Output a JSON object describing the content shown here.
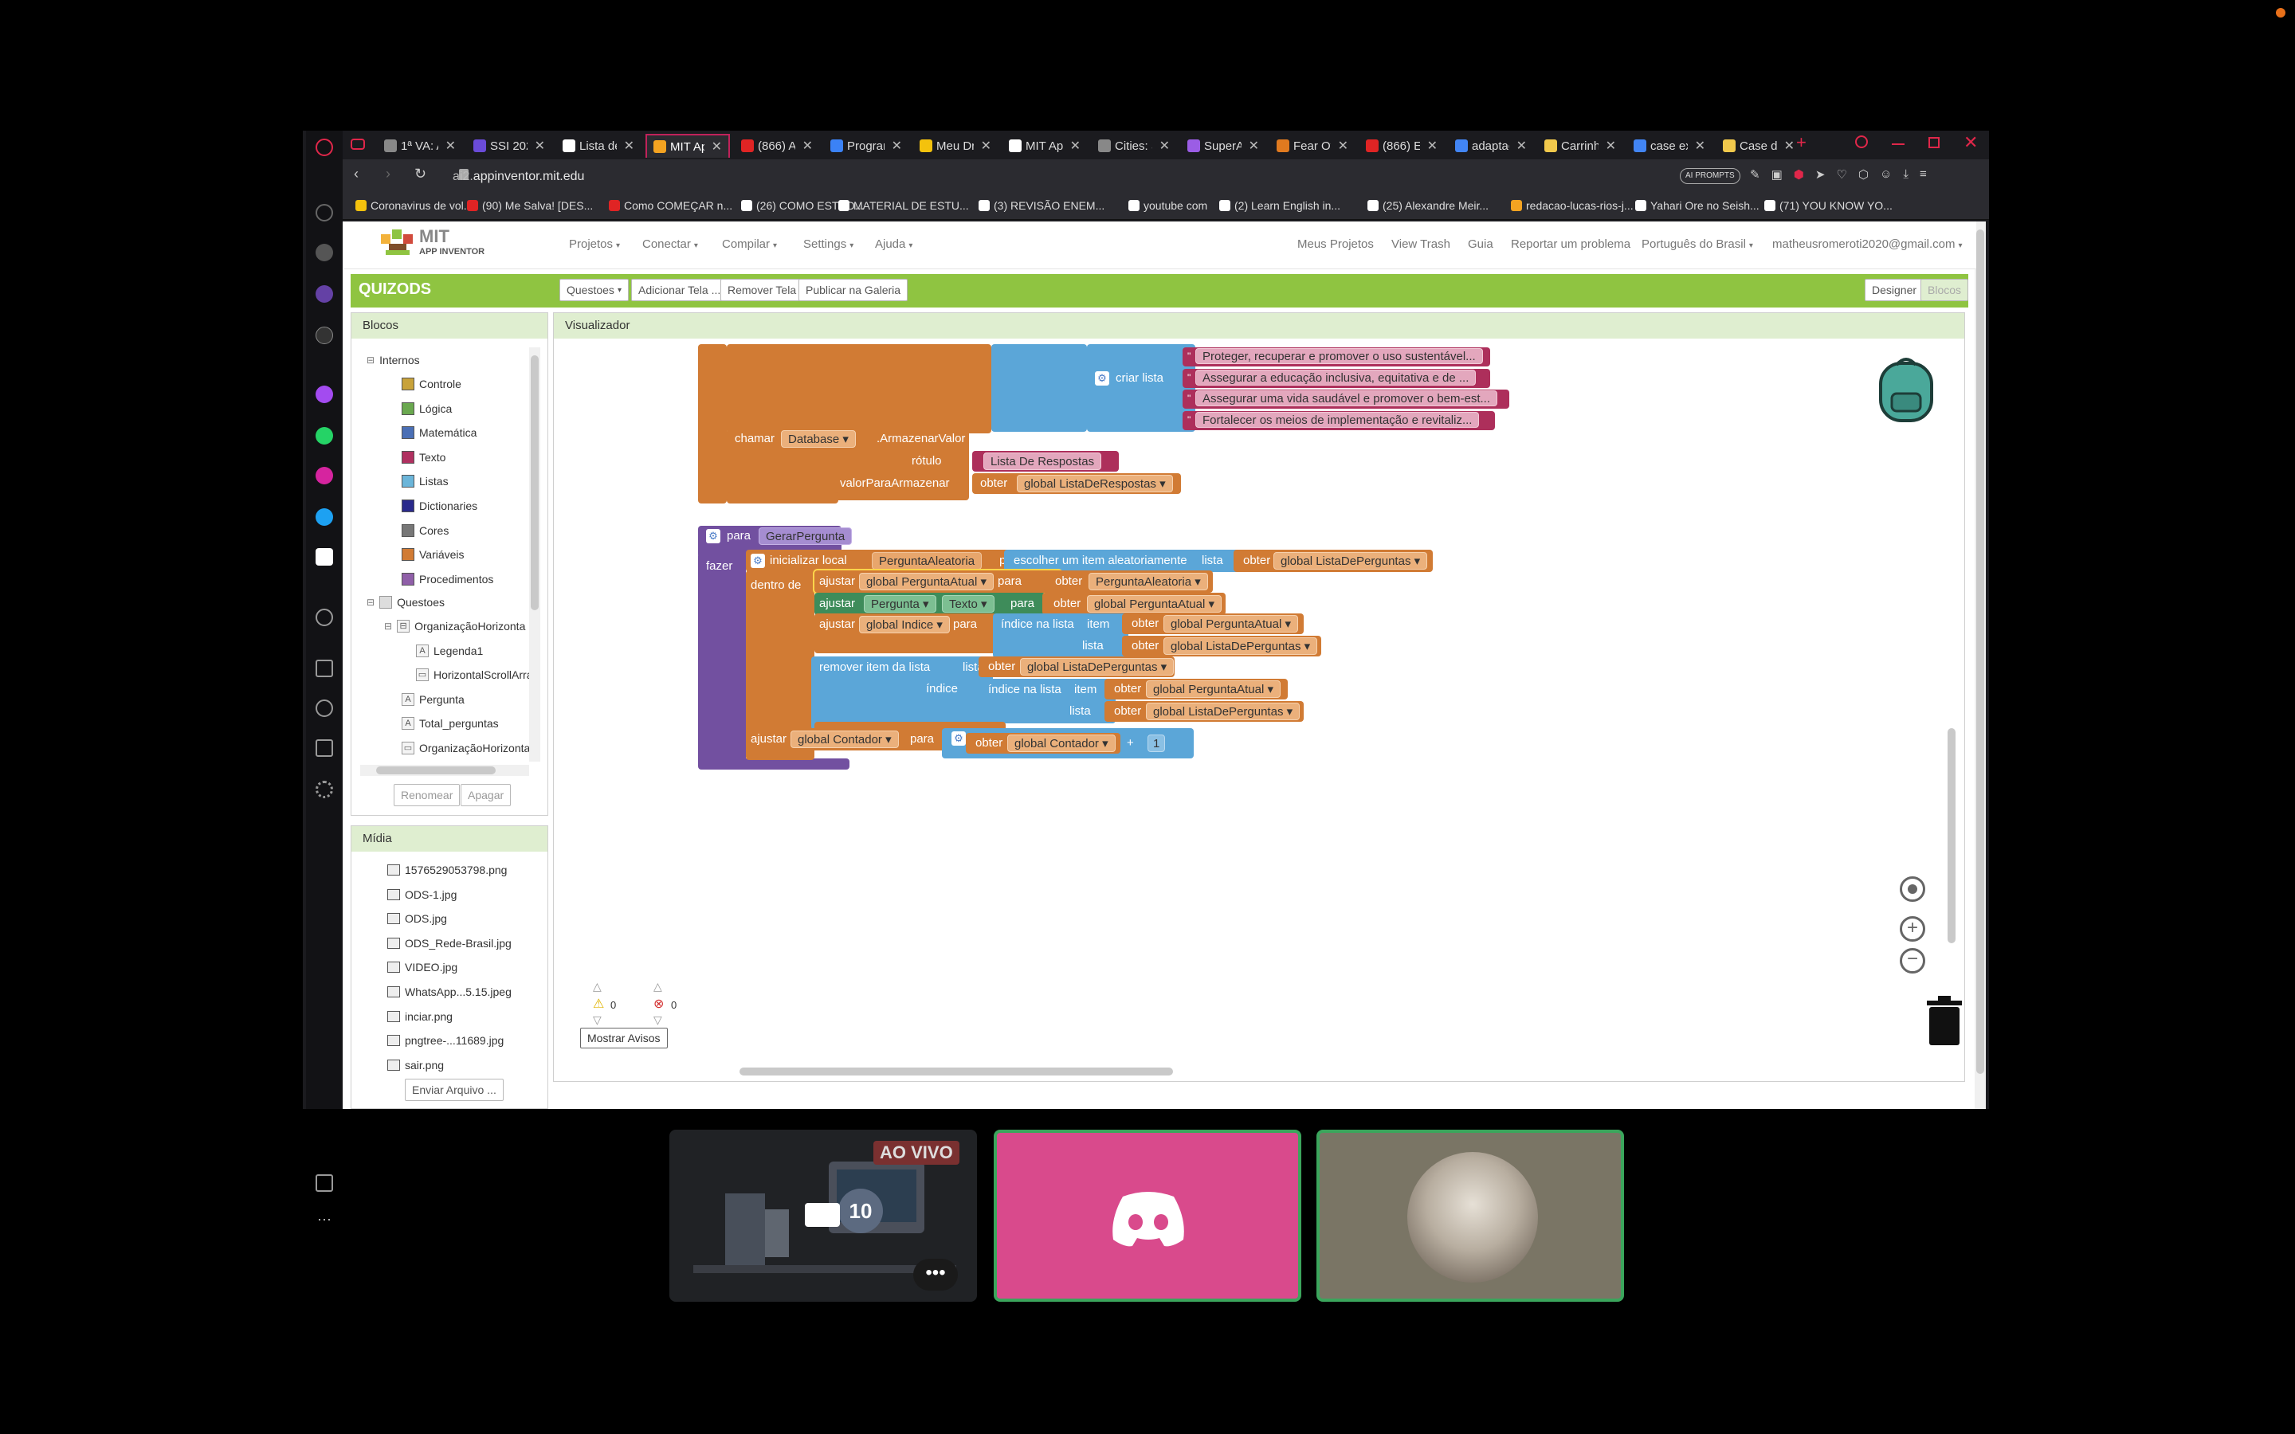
{
  "browser": {
    "tabs": [
      {
        "label": "1ª VA: A",
        "color": "#888"
      },
      {
        "label": "SSI 202",
        "color": "#6a4bd8"
      },
      {
        "label": "Lista de",
        "color": "#ffffff"
      },
      {
        "label": "MIT App",
        "color": "#f4a321",
        "active": true
      },
      {
        "label": "(866) Al",
        "color": "#e02424"
      },
      {
        "label": "Program",
        "color": "#3b82f6"
      },
      {
        "label": "Meu Dr",
        "color": "#f4c20d"
      },
      {
        "label": "MIT App",
        "color": "#ffffff"
      },
      {
        "label": "Cities: S",
        "color": "#888"
      },
      {
        "label": "SuperA",
        "color": "#9b5de5"
      },
      {
        "label": "Fear Of",
        "color": "#e07a1f"
      },
      {
        "label": "(866) El",
        "color": "#e02424"
      },
      {
        "label": "adaptac",
        "color": "#4285f4"
      },
      {
        "label": "Carrinh",
        "color": "#f2c94c"
      },
      {
        "label": "case ex",
        "color": "#4285f4"
      },
      {
        "label": "Case de",
        "color": "#f2c94c"
      }
    ],
    "url_prefix": "ai2.",
    "url_domain": "appinventor.mit.edu",
    "ai_prompts": "AI PROMPTS",
    "bookmarks": [
      "Coronavirus  de vol...",
      "(90) Me Salva! [DES...",
      "Como COMEÇAR n...",
      "(26) COMO ESTUD...",
      "MATERIAL DE ESTU...",
      "(3) REVISÃO ENEM...",
      "youtube com",
      "(2) Learn English in...",
      "(25) Alexandre Meir...",
      "redacao-lucas-rios-j...",
      "Yahari Ore no Seish...",
      "(71) YOU KNOW YO..."
    ]
  },
  "appinventor": {
    "logo_title": "MIT",
    "logo_sub": "APP INVENTOR",
    "menu": [
      "Projetos",
      "Conectar",
      "Compilar",
      "Settings",
      "Ajuda"
    ],
    "right_menu": [
      "Meus Projetos",
      "View Trash",
      "Guia",
      "Reportar um problema",
      "Português do Brasil",
      "matheusromeroti2020@gmail.com"
    ],
    "project_name": "QUIZODS",
    "screen_buttons": [
      "Questoes",
      "Adicionar Tela ...",
      "Remover Tela",
      "Publicar na Galeria"
    ],
    "designer": "Designer",
    "blocos": "Blocos"
  },
  "blocks_panel": {
    "title": "Blocos",
    "internos": "Internos",
    "builtin": [
      {
        "label": "Controle",
        "color": "#c8a23a"
      },
      {
        "label": "Lógica",
        "color": "#6aa84f"
      },
      {
        "label": "Matemática",
        "color": "#4a6fb5"
      },
      {
        "label": "Texto",
        "color": "#b03060"
      },
      {
        "label": "Listas",
        "color": "#6bb5d9"
      },
      {
        "label": "Dictionaries",
        "color": "#2a2a8c"
      },
      {
        "label": "Cores",
        "color": "#777777"
      },
      {
        "label": "Variáveis",
        "color": "#d17b34"
      },
      {
        "label": "Procedimentos",
        "color": "#8f5fa8"
      }
    ],
    "screen": "Questoes",
    "components": [
      "OrganizaçãoHorizonta",
      "Legenda1",
      "HorizontalScrollArra",
      "Pergunta",
      "Total_perguntas",
      "OrganizaçãoHorizonta"
    ],
    "rename": "Renomear",
    "delete": "Apagar"
  },
  "media_panel": {
    "title": "Mídia",
    "files": [
      "1576529053798.png",
      "ODS-1.jpg",
      "ODS.jpg",
      "ODS_Rede-Brasil.jpg",
      "VIDEO.jpg",
      "WhatsApp...5.15.jpeg",
      "inciar.png",
      "pngtree-...11689.jpg",
      "sair.png"
    ],
    "upload": "Enviar Arquivo ..."
  },
  "viewer": {
    "title": "Visualizador",
    "warnings_count": "0",
    "errors_count": "0",
    "show_warnings": "Mostrar Avisos"
  },
  "blocks": {
    "criar_lista": "criar lista",
    "list_items": [
      "Proteger, recuperar e promover o uso sustentável...",
      "Assegurar a educação inclusiva, equitativa e de ...",
      "Assegurar uma vida saudável e promover o bem-est...",
      "Fortalecer os meios de implementação e revitaliz..."
    ],
    "chamar": "chamar",
    "database": "Database",
    "armazenar": ".ArmazenarValor",
    "rotulo": "rótulo",
    "rotulo_value": "Lista De Respostas",
    "valor_param": "valorParaArmazenar",
    "obter": "obter",
    "global_lista_respostas": "global ListaDeRespostas",
    "para": "para",
    "proc_name": "GerarPergunta",
    "fazer": "fazer",
    "inicializar": "inicializar local",
    "pergunta_aleatoria": "PerguntaAleatoria",
    "escolher": "escolher um item aleatoriamente",
    "lista": "lista",
    "global_lista_perguntas": "global ListaDePerguntas",
    "dentro_de": "dentro de",
    "ajustar": "ajustar",
    "global_pergunta_atual": "global PerguntaAtual",
    "pergunta": "Pergunta",
    "texto": "Texto",
    "global_indice": "global Indice",
    "indice_na_lista": "índice na lista",
    "item": "item",
    "remover": "remover item da lista",
    "indice": "índice",
    "global_contador": "global Contador",
    "plus": "+",
    "one": "1"
  },
  "call": {
    "live": "AO VIVO",
    "timer": "10"
  }
}
